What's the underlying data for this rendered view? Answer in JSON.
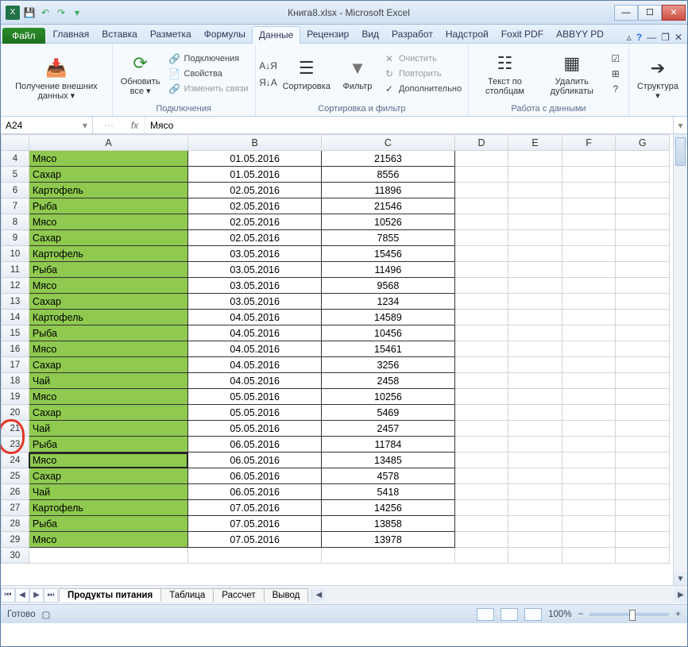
{
  "window": {
    "title": "Книга8.xlsx - Microsoft Excel"
  },
  "tabs": {
    "file": "Файл",
    "items": [
      "Главная",
      "Вставка",
      "Разметка",
      "Формулы",
      "Данные",
      "Рецензир",
      "Вид",
      "Разработ",
      "Надстрой",
      "Foxit PDF",
      "ABBYY PD"
    ],
    "active_index": 4
  },
  "ribbon": {
    "g1": {
      "btn": "Получение\nвнешних данных ▾",
      "label": ""
    },
    "g2": {
      "btn": "Обновить\nвсе ▾",
      "items": [
        "Подключения",
        "Свойства",
        "Изменить связи"
      ],
      "label": "Подключения"
    },
    "g3": {
      "sortAZ": "А↓Я",
      "sortZA": "Я↓А",
      "sort": "Сортировка",
      "filter": "Фильтр",
      "clear": "Очистить",
      "reapply": "Повторить",
      "adv": "Дополнительно",
      "label": "Сортировка и фильтр"
    },
    "g4": {
      "t2c": "Текст по\nстолбцам",
      "dedup": "Удалить\nдубликаты",
      "label": "Работа с данными"
    },
    "g5": {
      "btn": "Структура\n▾",
      "label": ""
    }
  },
  "formula_bar": {
    "name": "A24",
    "fx": "fx",
    "value": "Мясо"
  },
  "columns": [
    "A",
    "B",
    "C",
    "D",
    "E",
    "F",
    "G"
  ],
  "selected_cell": "A24",
  "rows": [
    {
      "n": 4,
      "a": "Мясо",
      "b": "01.05.2016",
      "c": "21563"
    },
    {
      "n": 5,
      "a": "Сахар",
      "b": "01.05.2016",
      "c": "8556"
    },
    {
      "n": 6,
      "a": "Картофель",
      "b": "02.05.2016",
      "c": "11896"
    },
    {
      "n": 7,
      "a": "Рыба",
      "b": "02.05.2016",
      "c": "21546"
    },
    {
      "n": 8,
      "a": "Мясо",
      "b": "02.05.2016",
      "c": "10526"
    },
    {
      "n": 9,
      "a": "Сахар",
      "b": "02.05.2016",
      "c": "7855"
    },
    {
      "n": 10,
      "a": "Картофель",
      "b": "03.05.2016",
      "c": "15456"
    },
    {
      "n": 11,
      "a": "Рыба",
      "b": "03.05.2016",
      "c": "11496"
    },
    {
      "n": 12,
      "a": "Мясо",
      "b": "03.05.2016",
      "c": "9568"
    },
    {
      "n": 13,
      "a": "Сахар",
      "b": "03.05.2016",
      "c": "1234"
    },
    {
      "n": 14,
      "a": "Картофель",
      "b": "04.05.2016",
      "c": "14589"
    },
    {
      "n": 15,
      "a": "Рыба",
      "b": "04.05.2016",
      "c": "10456"
    },
    {
      "n": 16,
      "a": "Мясо",
      "b": "04.05.2016",
      "c": "15461"
    },
    {
      "n": 17,
      "a": "Сахар",
      "b": "04.05.2016",
      "c": "3256"
    },
    {
      "n": 18,
      "a": "Чай",
      "b": "04.05.2016",
      "c": "2458"
    },
    {
      "n": 19,
      "a": "Мясо",
      "b": "05.05.2016",
      "c": "10256"
    },
    {
      "n": 20,
      "a": "Сахар",
      "b": "05.05.2016",
      "c": "5469"
    },
    {
      "n": 21,
      "a": "Чай",
      "b": "05.05.2016",
      "c": "2457"
    },
    {
      "n": 23,
      "a": "Рыба",
      "b": "06.05.2016",
      "c": "11784"
    },
    {
      "n": 24,
      "a": "Мясо",
      "b": "06.05.2016",
      "c": "13485",
      "selected": true
    },
    {
      "n": 25,
      "a": "Сахар",
      "b": "06.05.2016",
      "c": "4578"
    },
    {
      "n": 26,
      "a": "Чай",
      "b": "06.05.2016",
      "c": "5418"
    },
    {
      "n": 27,
      "a": "Картофель",
      "b": "07.05.2016",
      "c": "14256"
    },
    {
      "n": 28,
      "a": "Рыба",
      "b": "07.05.2016",
      "c": "13858"
    },
    {
      "n": 29,
      "a": "Мясо",
      "b": "07.05.2016",
      "c": "13978"
    },
    {
      "n": 30,
      "a": "",
      "b": "",
      "c": "",
      "empty": true
    }
  ],
  "callout_rows": [
    21,
    23
  ],
  "sheets": {
    "items": [
      "Продукты питания",
      "Таблица",
      "Рассчет",
      "Вывод"
    ],
    "active_index": 0
  },
  "status": {
    "ready": "Готово",
    "zoom": "100%"
  }
}
